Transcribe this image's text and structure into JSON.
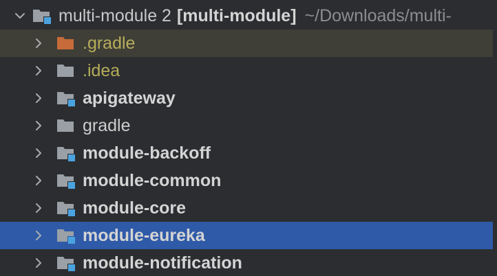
{
  "project_tree": {
    "root": {
      "name": "multi-module 2",
      "module": "[multi-module]",
      "path": "~/Downloads/multi-"
    },
    "items": [
      {
        "label": ".gradle",
        "icon": "folder-orange-icon",
        "style": "excluded",
        "state": "hover"
      },
      {
        "label": ".idea",
        "icon": "folder-icon",
        "style": "excluded",
        "state": ""
      },
      {
        "label": "apigateway",
        "icon": "module-folder-icon",
        "style": "bold",
        "state": ""
      },
      {
        "label": "gradle",
        "icon": "folder-icon",
        "style": "plain",
        "state": ""
      },
      {
        "label": "module-backoff",
        "icon": "module-folder-icon",
        "style": "bold",
        "state": ""
      },
      {
        "label": "module-common",
        "icon": "module-folder-icon",
        "style": "bold",
        "state": ""
      },
      {
        "label": "module-core",
        "icon": "module-folder-icon",
        "style": "bold",
        "state": ""
      },
      {
        "label": "module-eureka",
        "icon": "module-folder-icon",
        "style": "bold",
        "state": "selected"
      },
      {
        "label": "module-notification",
        "icon": "module-folder-icon",
        "style": "bold",
        "state": ""
      }
    ]
  },
  "colors": {
    "background": "#2b2d30",
    "selection": "#2f5aa8",
    "hover": "#3f3e37",
    "excluded_text": "#b6ad5a",
    "folder_gray": "#9aa0a6",
    "folder_orange": "#c76b3a",
    "module_badge": "#4aa3df"
  }
}
